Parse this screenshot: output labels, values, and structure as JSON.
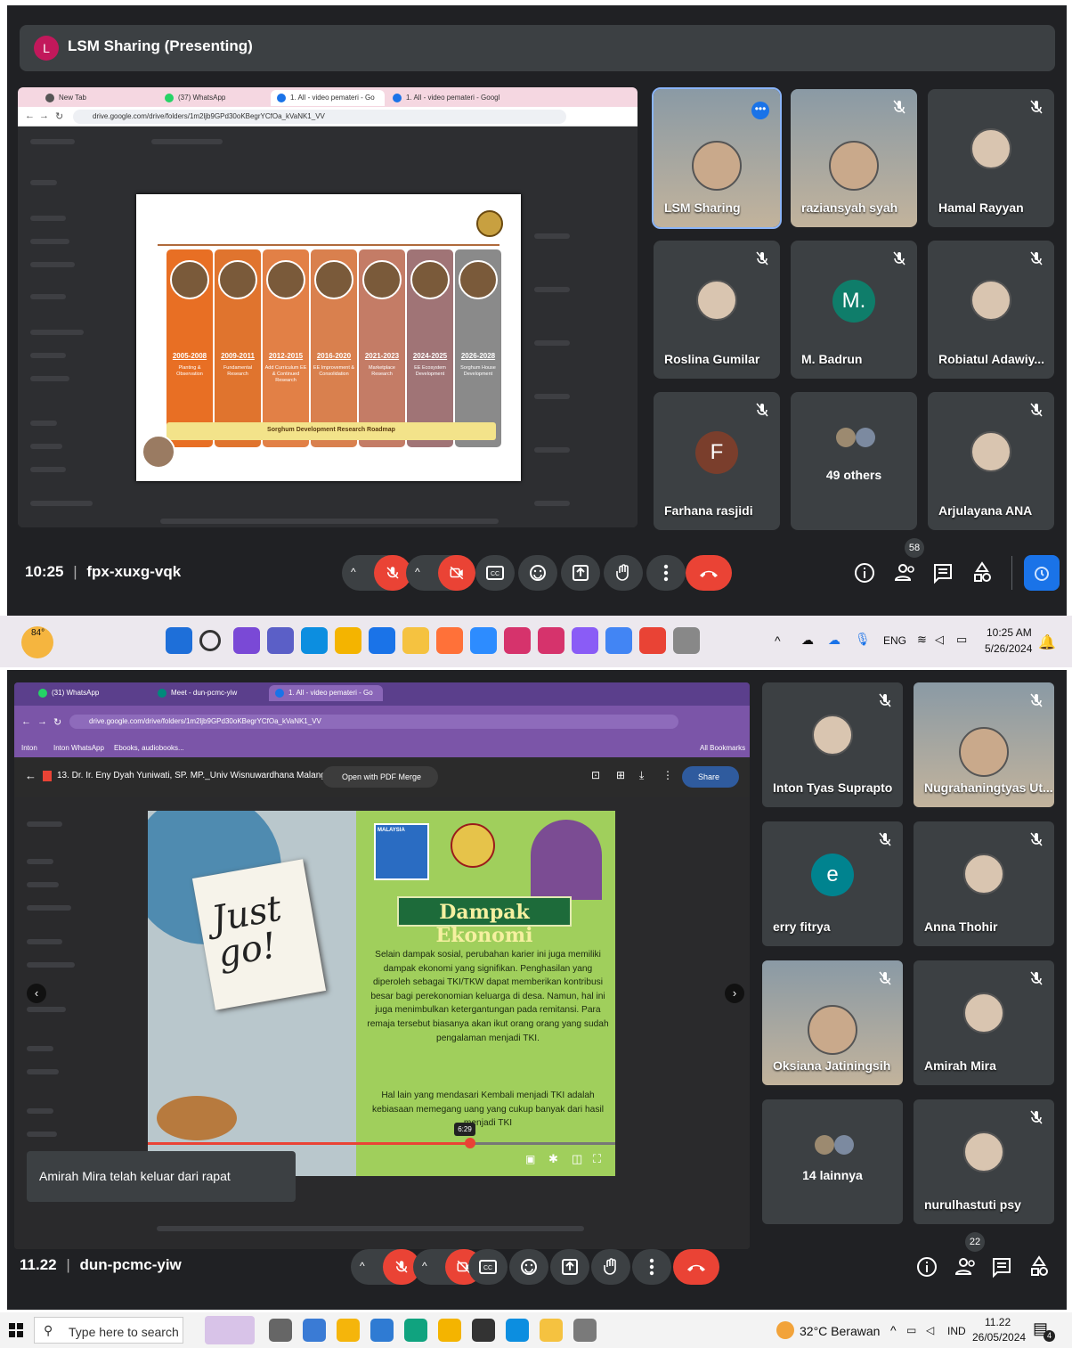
{
  "top_meet": {
    "presenter_initial": "L",
    "presenter_title": "LSM Sharing (Presenting)",
    "browser": {
      "tabs": [
        "New Tab",
        "(37) WhatsApp",
        "1. All - video pemateri - Go",
        "1. All - video pemateri - Googl"
      ],
      "url": "drive.google.com/drive/folders/1m2ljb9GPd30oKBegrYCfOa_kVaNK1_VV"
    },
    "slide": {
      "columns": [
        {
          "year": "2005-2008",
          "label": "Planting & Observation",
          "color": "#e86f24"
        },
        {
          "year": "2009-2011",
          "label": "Fundamental Research",
          "color": "#e0742e"
        },
        {
          "year": "2012-2015",
          "label": "Add Curriculum EE & Continued Research",
          "color": "#e28046"
        },
        {
          "year": "2016-2020",
          "label": "EE Improvement & Consolidation",
          "color": "#d9804e"
        },
        {
          "year": "2021-2023",
          "label": "Marketplace Research",
          "color": "#c47c66"
        },
        {
          "year": "2024-2025",
          "label": "EE Ecosystem Development",
          "color": "#a07476"
        },
        {
          "year": "2026-2028",
          "label": "Sorghum House Development",
          "color": "#8a8a8a"
        }
      ],
      "roadmap": "Sorghum Development Research Roadmap"
    },
    "participants": [
      {
        "name": "LSM Sharing",
        "kind": "video"
      },
      {
        "name": "raziansyah syah",
        "kind": "video"
      },
      {
        "name": "Hamal Rayyan",
        "kind": "photo"
      },
      {
        "name": "Roslina Gumilar",
        "kind": "photo"
      },
      {
        "name": "M. Badrun",
        "kind": "letter",
        "letter": "M.",
        "color": "#0f7d6a"
      },
      {
        "name": "Robiatul Adawiy...",
        "kind": "photo"
      },
      {
        "name": "Farhana rasjidi",
        "kind": "letter",
        "letter": "F",
        "color": "#7a3e2c"
      },
      {
        "name": "49 others",
        "kind": "others"
      },
      {
        "name": "Arjulayana ANA",
        "kind": "photo"
      }
    ],
    "time": "10:25",
    "meeting_code": "fpx-xuxg-vqk",
    "people_count": "58"
  },
  "taskbar_top": {
    "weather_temp": "84°",
    "language": "ENG",
    "time": "10:25 AM",
    "date": "5/26/2024"
  },
  "bottom_meet": {
    "browser": {
      "tabs": [
        "(31) WhatsApp",
        "Meet - dun-pcmc-yiw",
        "1. All - video pemateri - Go"
      ],
      "url": "drive.google.com/drive/folders/1m2ljb9GPd30oKBegrYCfOa_kVaNK1_VV",
      "bookmarks": [
        "Inton",
        "Inton WhatsApp",
        "Ebooks, audiobooks..."
      ],
      "all_bookmarks": "All Bookmarks"
    },
    "video": {
      "file_title": "13. Dr. Ir. Eny Dyah Yuniwati, SP. MP._Univ Wisnuwardhana Malang.mp4",
      "open_with": "Open with PDF Merge",
      "share": "Share",
      "note_text": "Just go!",
      "flag_label": "MALAYSIA",
      "slide_title": "Dampak Ekonomi",
      "paragraph1": "Selain dampak sosial, perubahan karier ini juga memiliki dampak ekonomi yang signifikan. Penghasilan yang diperoleh sebagai TKI/TKW dapat memberikan kontribusi besar bagi perekonomian keluarga di desa. Namun, hal ini juga menimbulkan ketergantungan pada remitansi.  Para remaja tersebut biasanya akan ikut orang orang yang sudah pengalaman menjadi TKI.",
      "paragraph2": "Hal lain yang mendasari Kembali menjadi TKI adalah kebiasaan memegang uang yang cukup banyak dari hasil menjadi TKI",
      "timestamp": "6:29",
      "progress": 0.69
    },
    "toast": "Amirah Mira telah keluar dari rapat",
    "participants": [
      {
        "name": "Inton Tyas Suprapto",
        "kind": "photo"
      },
      {
        "name": "Nugrahaningtyas Ut...",
        "kind": "video"
      },
      {
        "name": "erry fitrya",
        "kind": "letter",
        "letter": "e",
        "color": "#00838f"
      },
      {
        "name": "Anna Thohir",
        "kind": "photo"
      },
      {
        "name": "Oksiana Jatiningsih",
        "kind": "video"
      },
      {
        "name": "Amirah Mira",
        "kind": "photo"
      },
      {
        "name": "14 lainnya",
        "kind": "others"
      },
      {
        "name": "nurulhastuti psy",
        "kind": "photo"
      }
    ],
    "time": "11.22",
    "meeting_code": "dun-pcmc-yiw",
    "people_count": "22"
  },
  "taskbar_bottom": {
    "search_placeholder": "Type here to search",
    "weather": "32°C  Berawan",
    "language": "IND",
    "time": "11.22",
    "date": "26/05/2024",
    "notification_count": "4"
  }
}
